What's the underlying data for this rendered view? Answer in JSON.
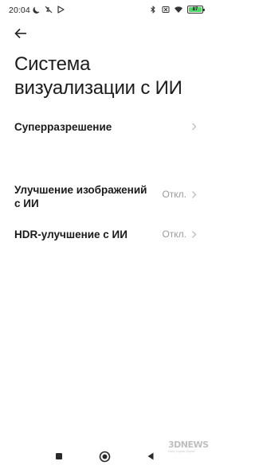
{
  "status_bar": {
    "time": "20:04",
    "left_icons": [
      "moon-icon",
      "muted-notification-icon",
      "play-store-icon"
    ],
    "right_icons": [
      "bluetooth-icon",
      "sim-off-icon",
      "wifi-icon",
      "battery-icon"
    ],
    "battery_level": "87"
  },
  "header": {
    "back_icon": "back-arrow-icon",
    "title": "Система визуализации с ИИ"
  },
  "settings": [
    {
      "label": "Суперразрешение",
      "value": ""
    },
    {
      "label": "Улучшение изображений с ИИ",
      "value": "Откл."
    },
    {
      "label": "HDR-улучшение с ИИ",
      "value": "Откл."
    }
  ],
  "nav_bar": {
    "icons": [
      "recent-apps-icon",
      "home-icon",
      "back-triangle-icon"
    ]
  },
  "watermark": {
    "brand": "3DNEWS",
    "tagline": "Daily Digital Digest"
  }
}
